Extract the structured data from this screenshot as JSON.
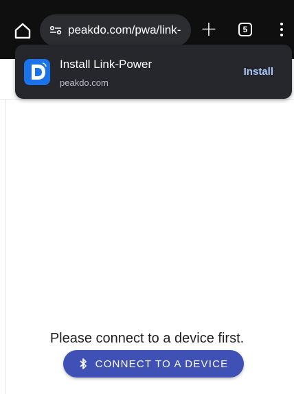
{
  "browser": {
    "url": "peakdo.com/pwa/link-",
    "tab_count": "5",
    "icons": {
      "home": "home-icon",
      "site_info": "tune-icon",
      "new_tab": "plus-icon",
      "tabs": "tab-switcher-icon",
      "menu": "more-vert-icon"
    }
  },
  "install_banner": {
    "app_name": "Install Link-Power",
    "domain": "peakdo.com",
    "install_label": "Install",
    "logo_icon": "link-power-logo"
  },
  "page": {
    "message": "Please connect to a device first.",
    "connect_label": "CONNECT TO A DEVICE",
    "connect_icon": "bluetooth-icon"
  },
  "colors": {
    "toolbar_bg": "#0f0f10",
    "banner_bg": "#25272d",
    "install_accent": "#a8c7fa",
    "button_bg": "#3f51b5",
    "logo_bg": "#1a73e8"
  }
}
